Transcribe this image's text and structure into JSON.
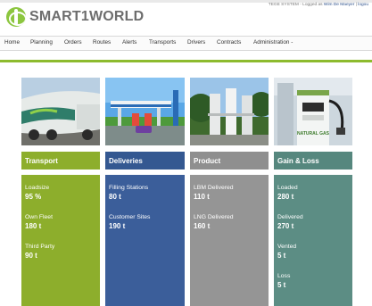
{
  "brand": {
    "name": "SMART1WORLD"
  },
  "user_info": {
    "prefix": "TEGE SYSTEM - Logged as",
    "user": "Wim De Maeyer",
    "logout": "logou"
  },
  "nav": [
    {
      "label": "Home"
    },
    {
      "label": "Planning"
    },
    {
      "label": "Orders"
    },
    {
      "label": "Routes"
    },
    {
      "label": "Alerts"
    },
    {
      "label": "Transports"
    },
    {
      "label": "Drivers"
    },
    {
      "label": "Contracts"
    },
    {
      "label": "Administration -"
    }
  ],
  "panels": [
    {
      "title": "Transport",
      "image": "lng-truck-photo",
      "color": "#8dae2c",
      "stats": [
        {
          "label": "Loadsize",
          "value": "95 %"
        },
        {
          "label": "Own Fleet",
          "value": "180 t"
        },
        {
          "label": "Third Party",
          "value": "90 t"
        }
      ]
    },
    {
      "title": "Deliveries",
      "image": "filling-station-photo",
      "color": "#3b5e9a",
      "stats": [
        {
          "label": "Filling Stations",
          "value": "80 t"
        },
        {
          "label": "Customer Sites",
          "value": "190 t"
        }
      ]
    },
    {
      "title": "Product",
      "image": "lng-tanks-photo",
      "color": "#959595",
      "stats": [
        {
          "label": "LBM Delivered",
          "value": "110 t"
        },
        {
          "label": "LNG Delivered",
          "value": "160 t"
        }
      ]
    },
    {
      "title": "Gain & Loss",
      "image": "natural-gas-pump-photo",
      "color": "#5c8d84",
      "stats": [
        {
          "label": "Loaded",
          "value": "280 t"
        },
        {
          "label": "Delivered",
          "value": "270 t"
        },
        {
          "label": "Vented",
          "value": "5 t"
        },
        {
          "label": "Loss",
          "value": "5 t"
        }
      ]
    }
  ],
  "pump_label": "NATURAL GAS"
}
